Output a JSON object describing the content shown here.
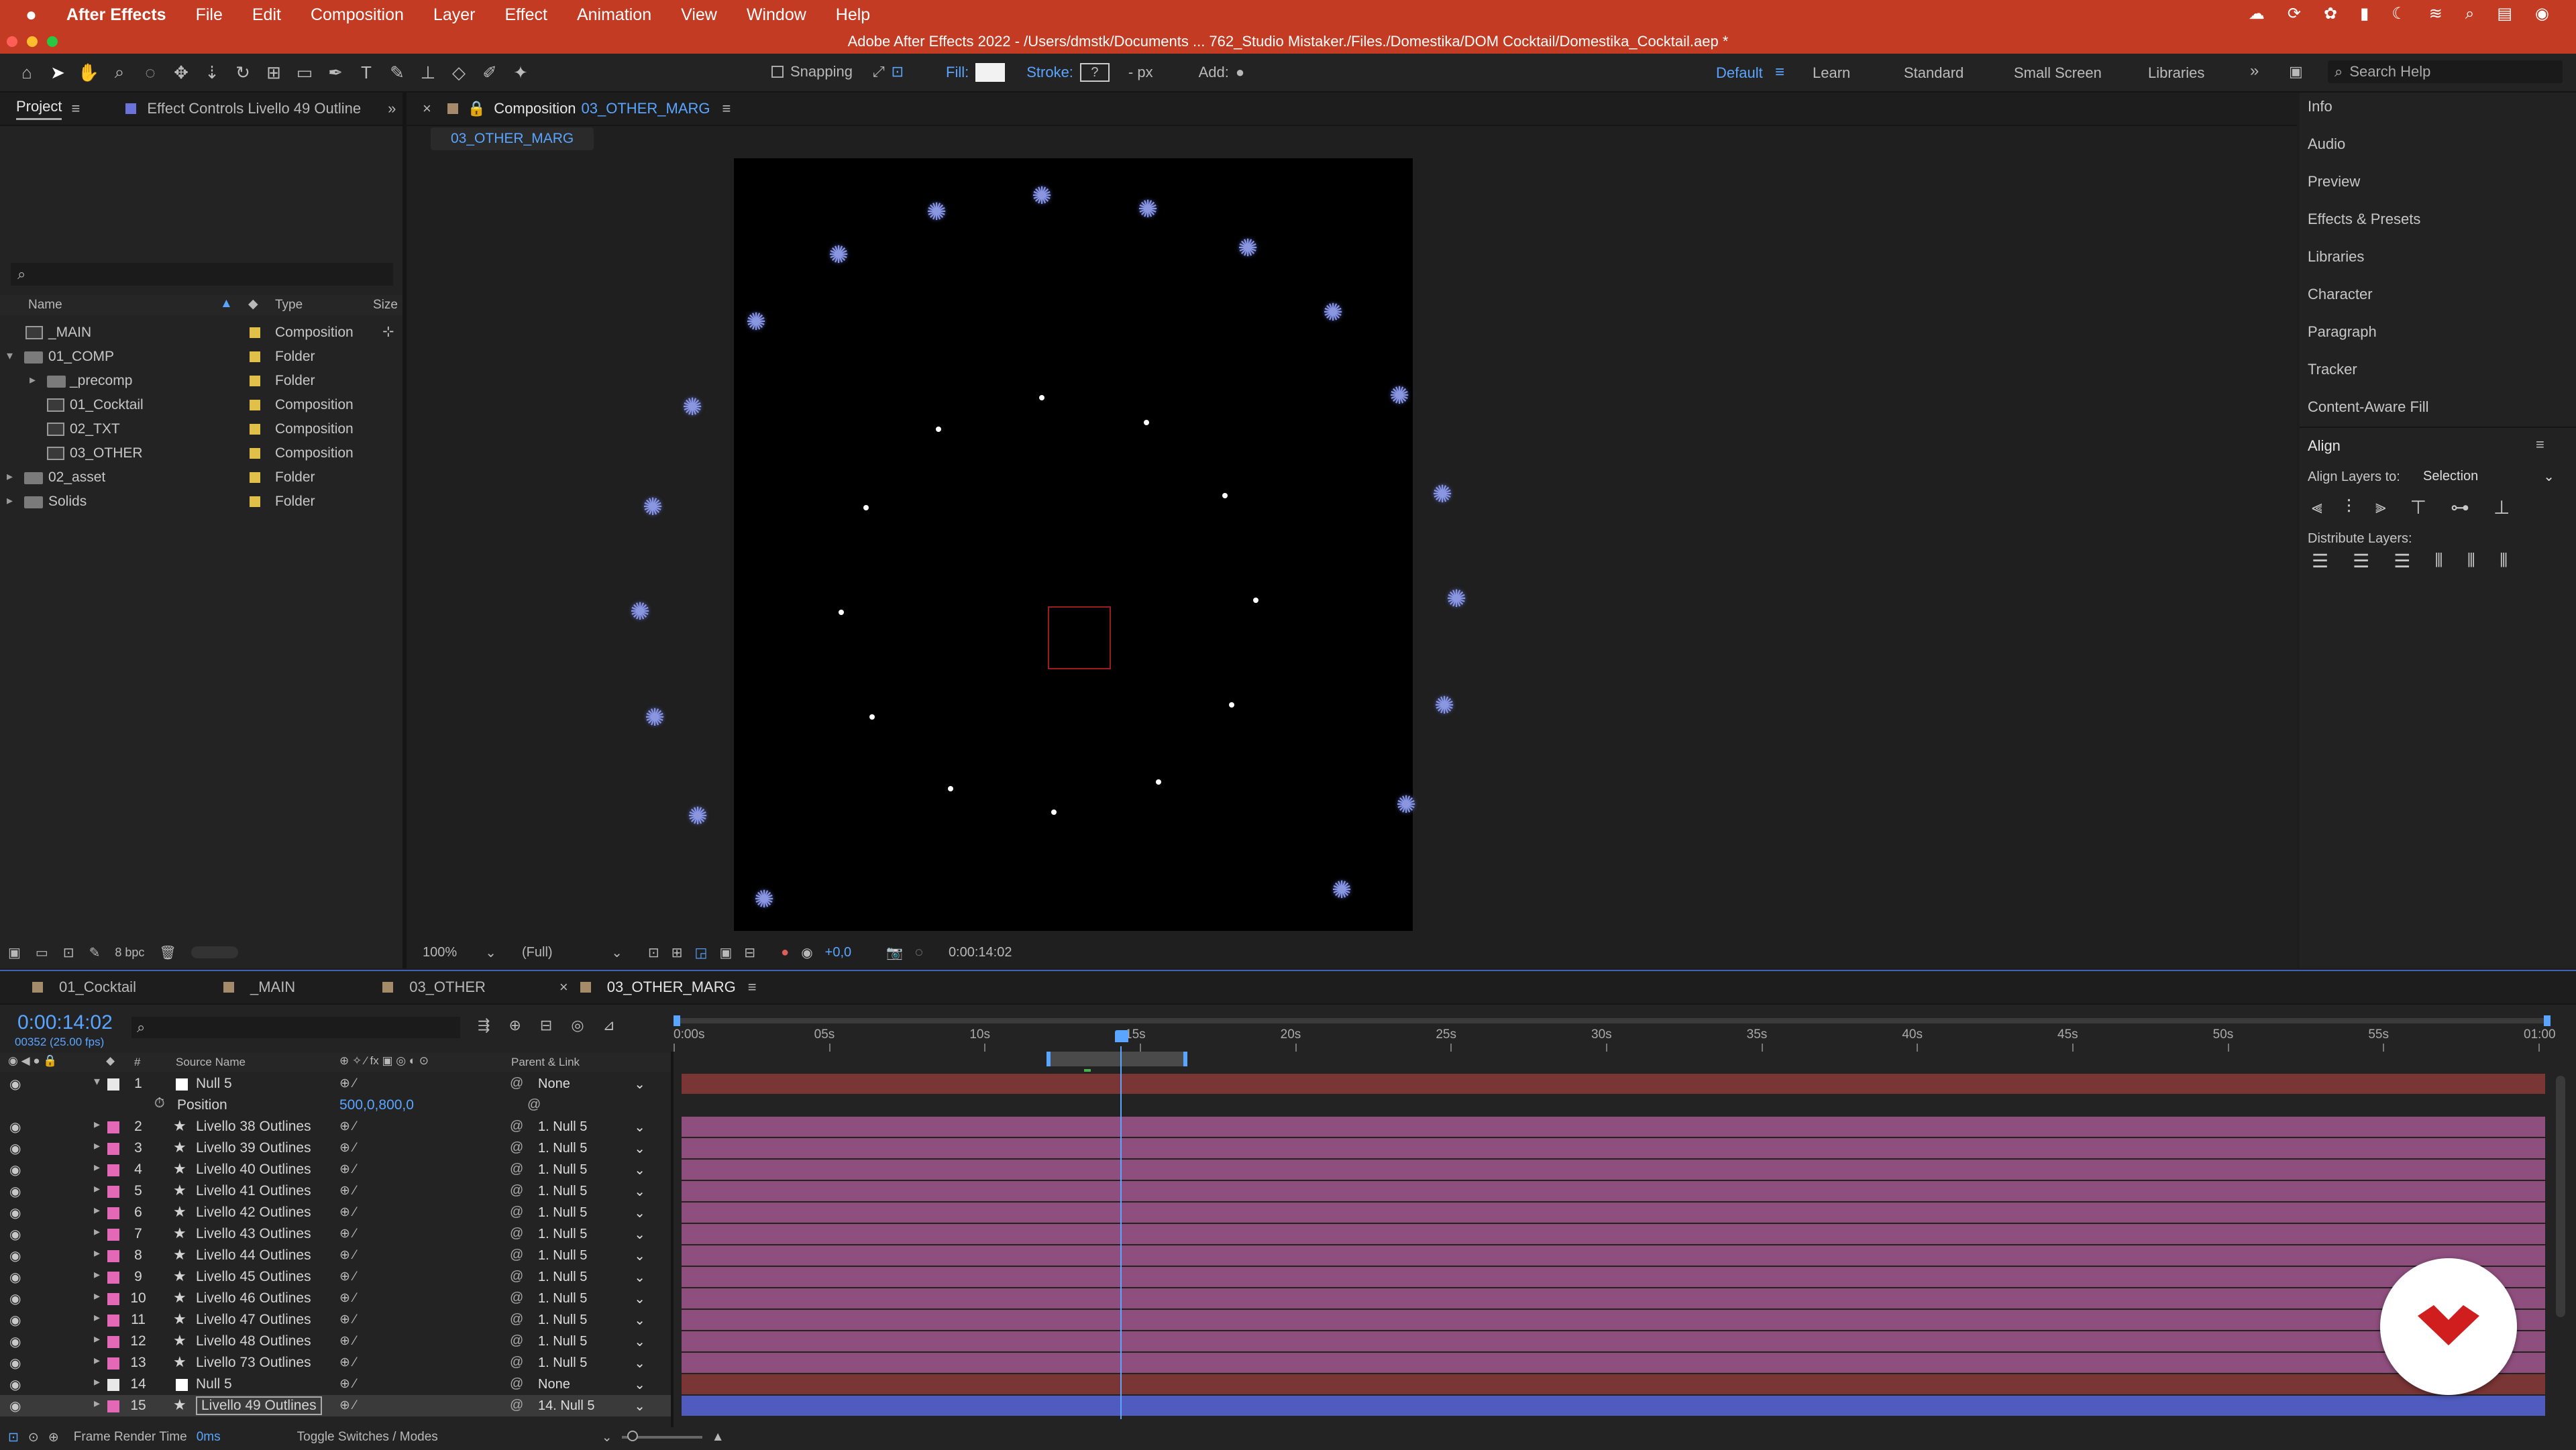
{
  "menubar": {
    "app": "After Effects",
    "items": [
      "File",
      "Edit",
      "Composition",
      "Layer",
      "Effect",
      "Animation",
      "View",
      "Window",
      "Help"
    ]
  },
  "titlebar": {
    "title": "Adobe After Effects 2022 - /Users/dmstk/Documents ... 762_Studio Mistaker./Files./Domestika/DOM Cocktail/Domestika_Cocktail.aep *"
  },
  "toolbar": {
    "snapping": "Snapping",
    "fill": "Fill:",
    "stroke": "Stroke:",
    "stroke_value": "?",
    "px": "- px",
    "add": "Add:",
    "workspaces": [
      "Default",
      "Learn",
      "Standard",
      "Small Screen",
      "Libraries"
    ],
    "search_placeholder": "Search Help"
  },
  "project": {
    "tab": "Project",
    "tab2": "Effect Controls Livello 49 Outline",
    "cols": {
      "name": "Name",
      "type": "Type",
      "size": "Size"
    },
    "rows": [
      {
        "name": "_MAIN",
        "type": "Composition"
      },
      {
        "name": "01_COMP",
        "type": "Folder"
      },
      {
        "name": "_precomp",
        "type": "Folder"
      },
      {
        "name": "01_Cocktail",
        "type": "Composition"
      },
      {
        "name": "02_TXT",
        "type": "Composition"
      },
      {
        "name": "03_OTHER",
        "type": "Composition"
      },
      {
        "name": "02_asset",
        "type": "Folder"
      },
      {
        "name": "Solids",
        "type": "Folder"
      }
    ],
    "bpc": "8 bpc"
  },
  "comp": {
    "tab_prefix": "Composition",
    "tab_name": "03_OTHER_MARG",
    "subtab": "03_OTHER_MARG",
    "zoom": "100%",
    "quality": "(Full)",
    "exposure": "+0,0",
    "timecode": "0:00:14:02"
  },
  "rightpanels": {
    "items": [
      "Info",
      "Audio",
      "Preview",
      "Effects & Presets",
      "Libraries",
      "Character",
      "Paragraph",
      "Tracker",
      "Content-Aware Fill"
    ],
    "align": "Align",
    "align_to_label": "Align Layers to:",
    "align_to_value": "Selection",
    "distribute": "Distribute Layers:"
  },
  "timeline": {
    "tabs": [
      "01_Cocktail",
      "_MAIN",
      "03_OTHER",
      "03_OTHER_MARG"
    ],
    "timecode": "0:00:14:02",
    "frames": "00352 (25.00 fps)",
    "col_source": "Source Name",
    "col_parent": "Parent & Link",
    "col_num": "#",
    "ticks": [
      "0:00s",
      "05s",
      "10s",
      "15s",
      "20s",
      "25s",
      "30s",
      "35s",
      "40s",
      "45s",
      "50s",
      "55s",
      "01:00"
    ],
    "position_label": "Position",
    "position_value": "500,0,800,0",
    "layers": [
      {
        "num": "1",
        "name": "Null 5",
        "parent": "None",
        "color": "#e8e8e8",
        "star": false
      },
      {
        "num": "2",
        "name": "Livello 38 Outlines",
        "parent": "1. Null 5",
        "color": "#e468b8",
        "star": true
      },
      {
        "num": "3",
        "name": "Livello 39 Outlines",
        "parent": "1. Null 5",
        "color": "#e468b8",
        "star": true
      },
      {
        "num": "4",
        "name": "Livello 40 Outlines",
        "parent": "1. Null 5",
        "color": "#e468b8",
        "star": true
      },
      {
        "num": "5",
        "name": "Livello 41 Outlines",
        "parent": "1. Null 5",
        "color": "#e468b8",
        "star": true
      },
      {
        "num": "6",
        "name": "Livello 42 Outlines",
        "parent": "1. Null 5",
        "color": "#e468b8",
        "star": true
      },
      {
        "num": "7",
        "name": "Livello 43 Outlines",
        "parent": "1. Null 5",
        "color": "#e468b8",
        "star": true
      },
      {
        "num": "8",
        "name": "Livello 44 Outlines",
        "parent": "1. Null 5",
        "color": "#e468b8",
        "star": true
      },
      {
        "num": "9",
        "name": "Livello 45 Outlines",
        "parent": "1. Null 5",
        "color": "#e468b8",
        "star": true
      },
      {
        "num": "10",
        "name": "Livello 46 Outlines",
        "parent": "1. Null 5",
        "color": "#e468b8",
        "star": true
      },
      {
        "num": "11",
        "name": "Livello 47 Outlines",
        "parent": "1. Null 5",
        "color": "#e468b8",
        "star": true
      },
      {
        "num": "12",
        "name": "Livello 48 Outlines",
        "parent": "1. Null 5",
        "color": "#e468b8",
        "star": true
      },
      {
        "num": "13",
        "name": "Livello 73 Outlines",
        "parent": "1. Null 5",
        "color": "#e468b8",
        "star": true
      },
      {
        "num": "14",
        "name": "Null 5",
        "parent": "None",
        "color": "#e8e8e8",
        "star": false
      },
      {
        "num": "15",
        "name": "Livello 49 Outlines",
        "parent": "14. Null 5",
        "color": "#e468b8",
        "star": true
      }
    ],
    "footer_render": "Frame Render Time",
    "footer_ms": "0ms",
    "footer_toggle": "Toggle Switches / Modes"
  },
  "colors": {
    "accent": "#5aa5ff",
    "menubar": "#c23b22",
    "pink_bar": "#8f4f7e",
    "red_bar": "#7a3535",
    "blue_bar": "#4f5bbf"
  }
}
